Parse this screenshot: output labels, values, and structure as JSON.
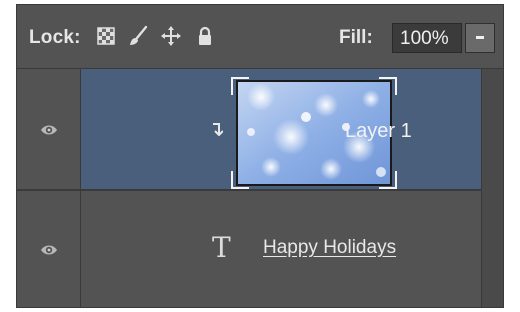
{
  "lockbar": {
    "lock_label": "Lock:",
    "lock_icons": [
      "transparency-checker-icon",
      "brush-icon",
      "move-arrows-icon",
      "padlock-icon"
    ],
    "fill_label": "Fill:",
    "fill_value": "100%"
  },
  "layers": [
    {
      "name": "Layer 1",
      "selected": true,
      "clipped": true,
      "thumbnail": "blue bokeh"
    },
    {
      "name": "Happy Holidays",
      "type": "text"
    }
  ],
  "colors": {
    "panel_bg": "#535353",
    "selected_row": "#4a5f7b",
    "text": "#f2f2f2"
  }
}
